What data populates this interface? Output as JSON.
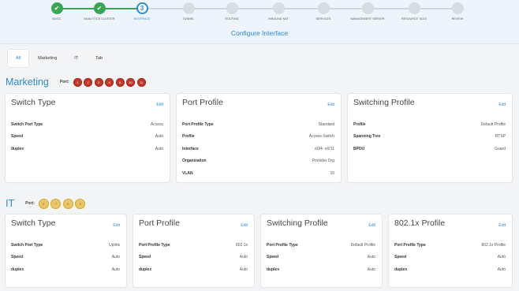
{
  "wizard": {
    "steps": [
      {
        "label": "BASIC",
        "state": "done"
      },
      {
        "label": "ANALYTICS CLUSTER",
        "state": "done"
      },
      {
        "label": "INTERFACE",
        "state": "current",
        "number": "3"
      },
      {
        "label": "TUNNEL",
        "state": "todo"
      },
      {
        "label": "ROUTING",
        "state": "todo"
      },
      {
        "label": "INBOUND NAT",
        "state": "todo"
      },
      {
        "label": "SERVICES",
        "state": "todo"
      },
      {
        "label": "MANAGEMENT SERVER",
        "state": "todo"
      },
      {
        "label": "RESOURCE TAGS",
        "state": "todo"
      },
      {
        "label": "REVIEW",
        "state": "todo"
      }
    ],
    "title": "Configure Interface"
  },
  "tabs": [
    "All",
    "Marketing",
    "IT",
    "Tab"
  ],
  "groups": {
    "marketing": {
      "title": "Marketing",
      "port_label": "Port:",
      "ports": [
        "1",
        "2",
        "3",
        "4",
        "5",
        "10",
        "11"
      ],
      "cards": [
        {
          "title": "Switch Type",
          "edit": "Edit",
          "rows": [
            {
              "k": "Switch Port Type",
              "v": "Access"
            },
            {
              "k": "Speed",
              "v": "Auto"
            },
            {
              "k": "duplex",
              "v": "Auto"
            }
          ]
        },
        {
          "title": "Port Profile",
          "edit": "Edit",
          "rows": [
            {
              "k": "Port Profile Type",
              "v": "Standard"
            },
            {
              "k": "Profile",
              "v": "Access Switch"
            },
            {
              "k": "Interface",
              "v": "e0/4- e0/11"
            },
            {
              "k": "Organization",
              "v": "Provider Org"
            },
            {
              "k": "VLAN",
              "v": "10"
            }
          ]
        },
        {
          "title": "Switching  Profile",
          "edit": "Edit",
          "rows": [
            {
              "k": "Profile",
              "v": "Default Profile"
            },
            {
              "k": "Spanning Tree",
              "v": "RTSP"
            },
            {
              "k": "BPDU",
              "v": "Guard"
            }
          ]
        }
      ]
    },
    "it": {
      "title": "IT",
      "port_label": "Port:",
      "ports": [
        "6",
        "7",
        "8",
        "9"
      ],
      "cards": [
        {
          "title": "Switch Type",
          "edit": "Edit",
          "rows": [
            {
              "k": "Switch Port Type",
              "v": "Uplink"
            },
            {
              "k": "Speed",
              "v": "Auto"
            },
            {
              "k": "duplex",
              "v": "Auto"
            }
          ]
        },
        {
          "title": "Port Profile",
          "edit": "Edit",
          "rows": [
            {
              "k": "Port Profile Type",
              "v": "802.1x"
            },
            {
              "k": "Speed",
              "v": "Auto"
            },
            {
              "k": "duplex",
              "v": "Auto"
            }
          ]
        },
        {
          "title": "Switching  Profile",
          "edit": "Edit",
          "rows": [
            {
              "k": "Port Profile Type",
              "v": "Default Profile"
            },
            {
              "k": "Speed",
              "v": "Auto"
            },
            {
              "k": "duplex",
              "v": "Auto"
            }
          ]
        },
        {
          "title": "802.1x Profile",
          "edit": "Edit",
          "rows": [
            {
              "k": "Port Profile Type",
              "v": "802.1x Profile"
            },
            {
              "k": "Speed",
              "v": "Auto"
            },
            {
              "k": "duplex",
              "v": "Auto"
            }
          ]
        }
      ]
    }
  },
  "colors": {
    "accent": "#2a8ad4",
    "done": "#3aa655",
    "port_marketing": "#c0392b",
    "port_it": "#e9c66a"
  }
}
